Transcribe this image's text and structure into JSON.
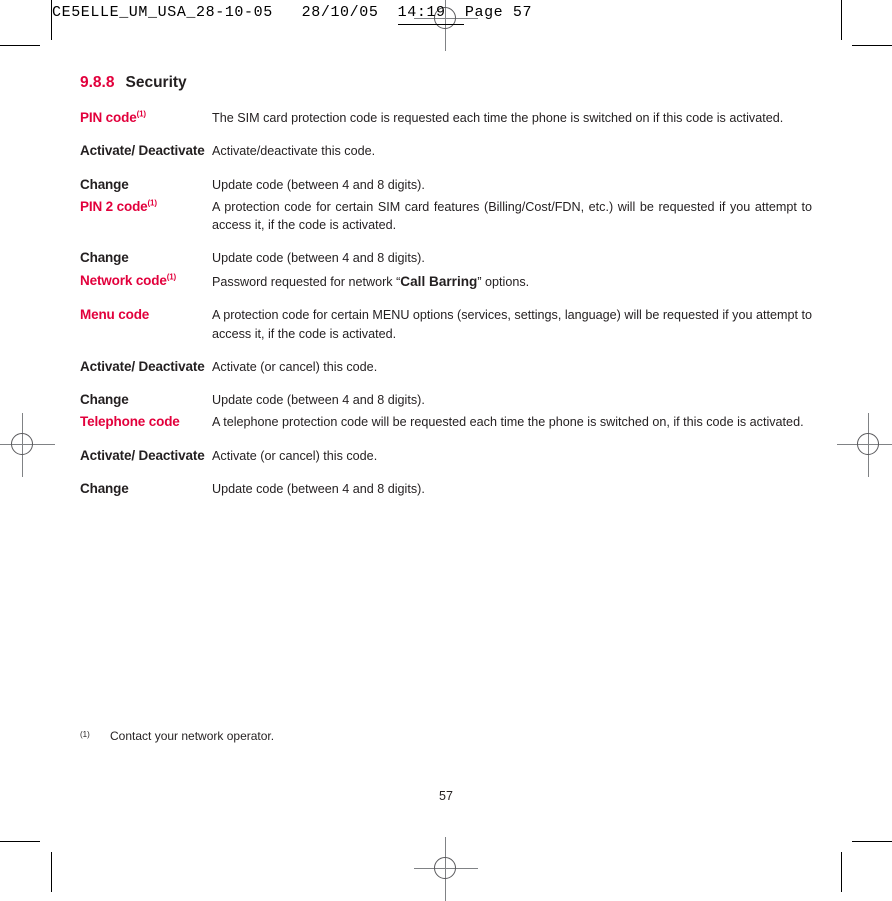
{
  "header": {
    "slug": "CE5ELLE_UM_USA_28-10-05   28/10/05  14:19  Page 57"
  },
  "section": {
    "number": "9.8.8",
    "title": "Security"
  },
  "entries": [
    {
      "term": "PIN code",
      "footnote_ref": "(1)",
      "accent": true,
      "description": "The SIM card protection code is requested each time the phone is switched on if this code is activated.",
      "justify": false
    },
    {
      "term": "Activate/ Deactivate",
      "footnote_ref": "",
      "accent": false,
      "description": "Activate/deactivate this code.",
      "justify": false
    },
    {
      "term": "Change",
      "footnote_ref": "",
      "accent": false,
      "description": "Update code (between 4 and 8 digits).",
      "justify": false
    },
    {
      "term": "PIN 2 code",
      "footnote_ref": "(1)",
      "accent": true,
      "description": "A protection code for certain SIM card features (Billing/Cost/FDN, etc.) will be requested if you attempt to access it, if the code is activated.",
      "justify": true
    },
    {
      "term": "Change",
      "footnote_ref": "",
      "accent": false,
      "description": "Update code (between 4 and 8 digits).",
      "justify": false
    },
    {
      "term": "Network code",
      "footnote_ref": "(1)",
      "accent": true,
      "description_pre": "Password requested for network “",
      "description_bold": "Call Barring",
      "description_post": "” options.",
      "justify": false
    },
    {
      "term": "Menu code",
      "footnote_ref": "",
      "accent": true,
      "description": "A protection code for certain MENU options (services, settings, language) will be requested if you attempt to access it, if the code is activated.",
      "justify": true
    },
    {
      "term": "Activate/ Deactivate",
      "footnote_ref": "",
      "accent": false,
      "description": "Activate (or cancel) this code.",
      "justify": false
    },
    {
      "term": "Change",
      "footnote_ref": "",
      "accent": false,
      "description": "Update code (between 4 and 8 digits).",
      "justify": false
    },
    {
      "term": "Telephone code",
      "footnote_ref": "",
      "accent": true,
      "description": "A telephone protection code will be requested each time the phone is switched on, if this code is activated.",
      "justify": true
    },
    {
      "term": "Activate/ Deactivate",
      "footnote_ref": "",
      "accent": false,
      "description": "Activate (or cancel) this code.",
      "justify": false
    },
    {
      "term": "Change",
      "footnote_ref": "",
      "accent": false,
      "description": "Update code (between 4 and 8 digits).",
      "justify": false
    }
  ],
  "footnote": {
    "marker": "(1)",
    "text": "Contact your network operator."
  },
  "folio": {
    "page_number": "57"
  },
  "colors": {
    "accent": "#E2003C",
    "text": "#231F20",
    "registration": "#808285"
  }
}
